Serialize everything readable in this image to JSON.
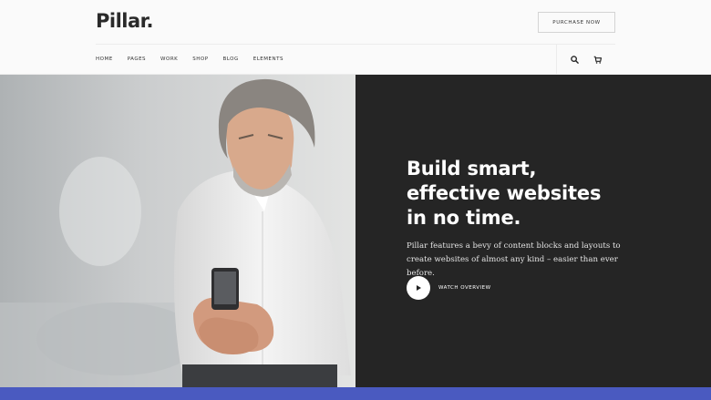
{
  "header": {
    "logo": "Pillar.",
    "purchase_label": "PURCHASE NOW",
    "nav": [
      "HOME",
      "PAGES",
      "WORK",
      "SHOP",
      "BLOG",
      "ELEMENTS"
    ],
    "icons": [
      "search-icon",
      "cart-icon"
    ]
  },
  "hero": {
    "headline_lines": [
      "Build smart,",
      "effective websites",
      "in no time."
    ],
    "subtext": "Pillar features a bevy of content blocks and layouts to create websites of almost any kind – easier than ever before.",
    "watch_label": "WATCH OVERVIEW"
  },
  "colors": {
    "accent_bar": "#4a5ac0",
    "dark_panel": "#252525"
  }
}
